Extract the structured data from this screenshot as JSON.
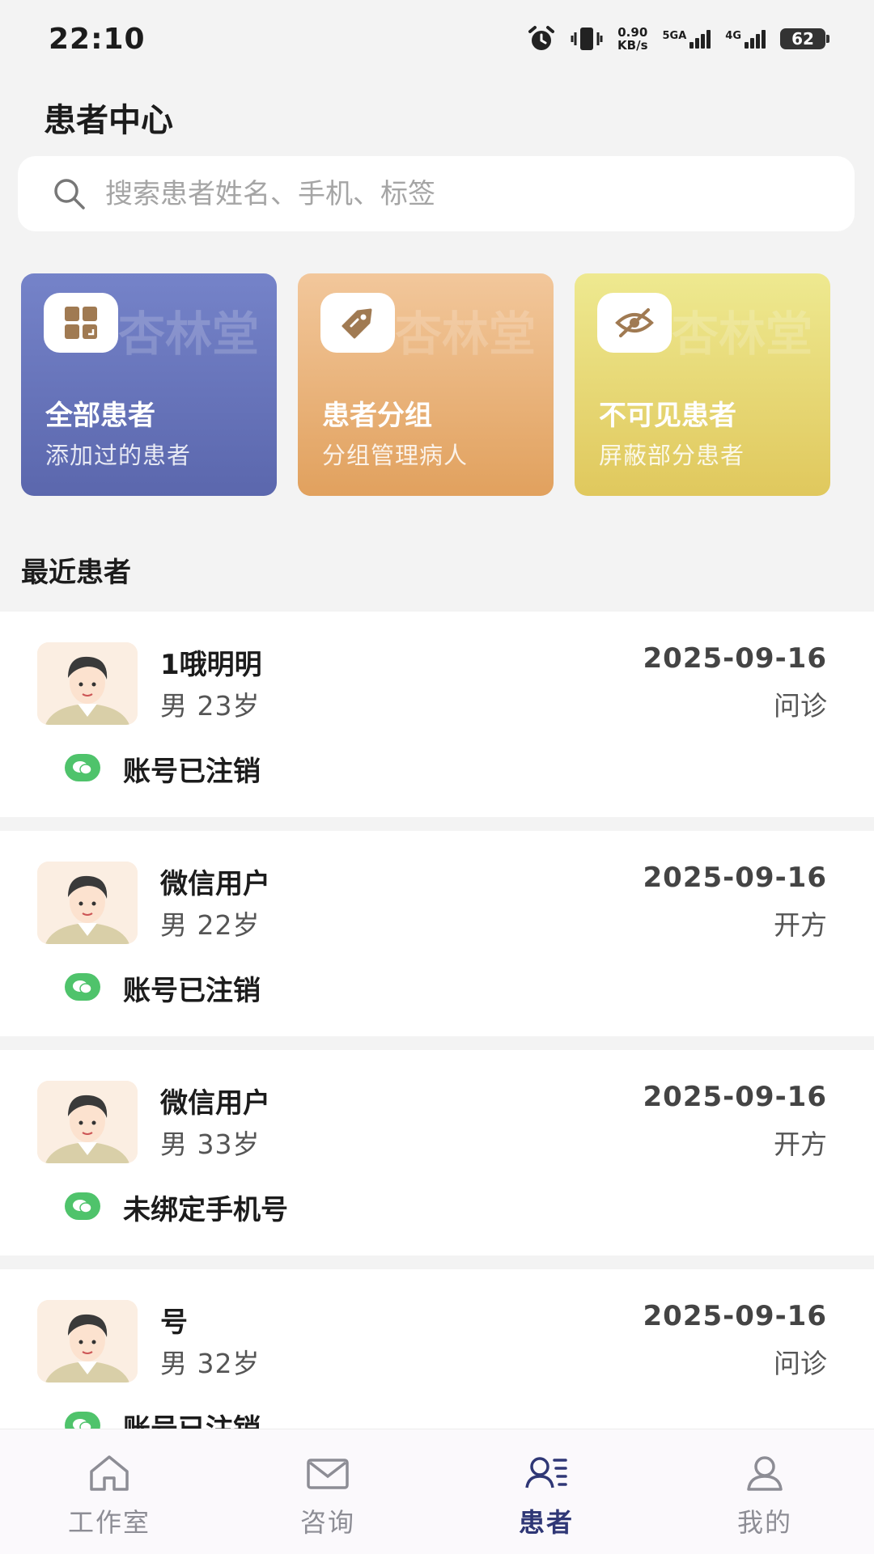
{
  "status_bar": {
    "time": "22:10",
    "net_speed_value": "0.90",
    "net_speed_unit": "KB/s",
    "signal1_label": "5GA",
    "signal2_label": "4G",
    "battery": "62"
  },
  "page_title": "患者中心",
  "search": {
    "placeholder": "搜索患者姓名、手机、标签"
  },
  "cards": [
    {
      "title": "全部患者",
      "subtitle": "添加过的患者",
      "watermark": "杏林堂",
      "icon": "grid-icon"
    },
    {
      "title": "患者分组",
      "subtitle": "分组管理病人",
      "watermark": "杏林堂",
      "icon": "tag-icon"
    },
    {
      "title": "不可见患者",
      "subtitle": "屏蔽部分患者",
      "watermark": "杏林堂",
      "icon": "eye-off-icon"
    }
  ],
  "recent_title": "最近患者",
  "patients": [
    {
      "name": "1哦明明",
      "info": "男 23岁",
      "date": "2025-09-16",
      "type": "问诊",
      "status": "账号已注销"
    },
    {
      "name": "微信用户",
      "info": "男 22岁",
      "date": "2025-09-16",
      "type": "开方",
      "status": "账号已注销"
    },
    {
      "name": "微信用户",
      "info": "男 33岁",
      "date": "2025-09-16",
      "type": "开方",
      "status": "未绑定手机号"
    },
    {
      "name": "号",
      "info": "男 32岁",
      "date": "2025-09-16",
      "type": "问诊",
      "status": "账号已注销"
    }
  ],
  "tabs": [
    {
      "label": "工作室",
      "icon": "home-icon",
      "active": false
    },
    {
      "label": "咨询",
      "icon": "mail-icon",
      "active": false
    },
    {
      "label": "患者",
      "icon": "patients-icon",
      "active": true
    },
    {
      "label": "我的",
      "icon": "user-icon",
      "active": false
    }
  ]
}
